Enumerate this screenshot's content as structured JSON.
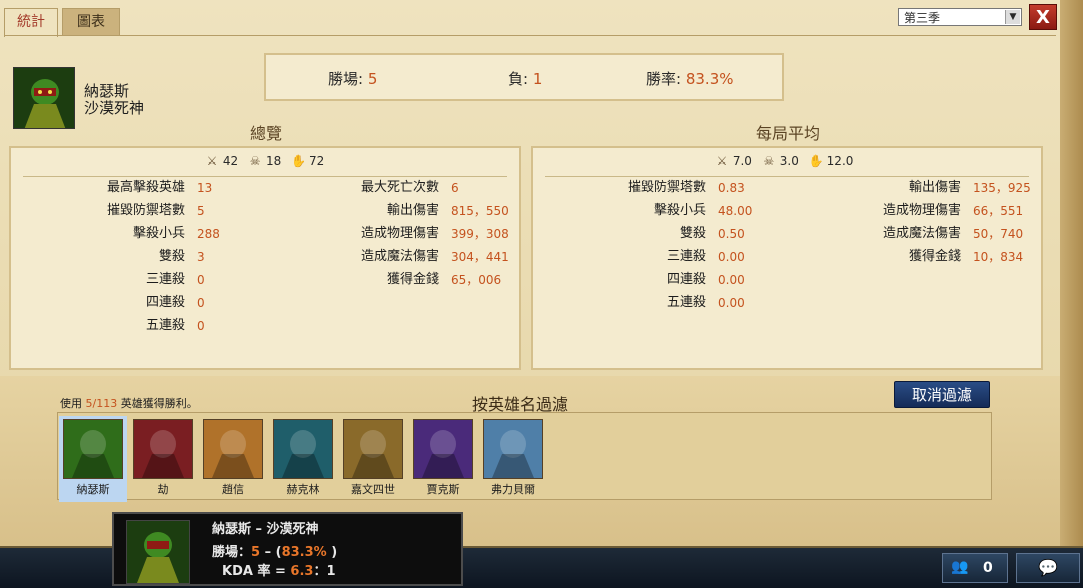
{
  "tabs": [
    {
      "label": "統計"
    },
    {
      "label": "圖表"
    }
  ],
  "season": {
    "selected": "第三季"
  },
  "close_glyph": "X",
  "champion": {
    "name": "納瑟斯",
    "title": "沙漠死神"
  },
  "summary": {
    "wins_label": "勝場:",
    "wins": "5",
    "losses_label": "負:",
    "losses": "1",
    "winrate_label": "勝率:",
    "winrate": "83.3%"
  },
  "overview": {
    "title": "總覽",
    "kda": {
      "kills": "42",
      "deaths": "18",
      "assists": "72"
    },
    "left_rows": [
      {
        "label": "最高擊殺英雄",
        "value": "13"
      },
      {
        "label": "摧毀防禦塔數",
        "value": "5"
      },
      {
        "label": "擊殺小兵",
        "value": "288"
      },
      {
        "label": "雙殺",
        "value": "3"
      },
      {
        "label": "三連殺",
        "value": "0"
      },
      {
        "label": "四連殺",
        "value": "0"
      },
      {
        "label": "五連殺",
        "value": "0"
      }
    ],
    "right_rows": [
      {
        "label": "最大死亡次數",
        "value": "6"
      },
      {
        "label": "輸出傷害",
        "value": "815，550"
      },
      {
        "label": "造成物理傷害",
        "value": "399，308"
      },
      {
        "label": "造成魔法傷害",
        "value": "304，441"
      },
      {
        "label": "獲得金錢",
        "value": "65，006"
      }
    ]
  },
  "average": {
    "title": "每局平均",
    "kda": {
      "kills": "7.0",
      "deaths": "3.0",
      "assists": "12.0"
    },
    "left_rows": [
      {
        "label": "摧毀防禦塔數",
        "value": "0.83"
      },
      {
        "label": "擊殺小兵",
        "value": "48.00"
      },
      {
        "label": "雙殺",
        "value": "0.50"
      },
      {
        "label": "三連殺",
        "value": "0.00"
      },
      {
        "label": "四連殺",
        "value": "0.00"
      },
      {
        "label": "五連殺",
        "value": "0.00"
      }
    ],
    "right_rows": [
      {
        "label": "輸出傷害",
        "value": "135，925"
      },
      {
        "label": "造成物理傷害",
        "value": "66，551"
      },
      {
        "label": "造成魔法傷害",
        "value": "50，740"
      },
      {
        "label": "獲得金錢",
        "value": "10，834"
      }
    ]
  },
  "filter": {
    "caption_prefix": "使用",
    "caption_count": "5/113",
    "caption_suffix": "英雄獲得勝利。",
    "title": "按英雄名過濾",
    "clear_label": "取消過濾",
    "champions": [
      {
        "name": "納瑟斯",
        "selected": true,
        "color": "#2f6d1a"
      },
      {
        "name": "劫",
        "selected": false,
        "color": "#7a1e22"
      },
      {
        "name": "趙信",
        "selected": false,
        "color": "#b0722a"
      },
      {
        "name": "赫克林",
        "selected": false,
        "color": "#1f5e6a"
      },
      {
        "name": "嘉文四世",
        "selected": false,
        "color": "#8a6a2a"
      },
      {
        "name": "賈克斯",
        "selected": false,
        "color": "#4a2a7a"
      },
      {
        "name": "弗力貝爾",
        "selected": false,
        "color": "#4f7fa8"
      }
    ]
  },
  "tooltip": {
    "title": "納瑟斯 – 沙漠死神",
    "wins_label": "勝場：",
    "wins": "5",
    "sep": " – (",
    "winrate": "83.3%",
    "close": " )",
    "kda_label": "KDA 率 = ",
    "kda_value": "6.3",
    "kda_suffix": "：1"
  },
  "footer": {
    "friends_count": "0"
  }
}
